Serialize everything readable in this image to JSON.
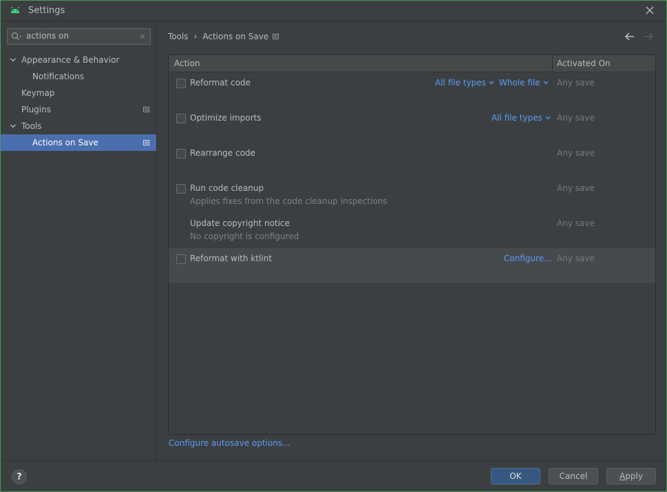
{
  "window": {
    "title": "Settings"
  },
  "colors": {
    "accent": "#4b6eaf",
    "link": "#589df6",
    "border": "#499c54",
    "primary_button": "#365880"
  },
  "search": {
    "value": "actions on"
  },
  "sidebar": {
    "items": [
      {
        "label": "Appearance & Behavior",
        "expanded": true
      },
      {
        "label": "Notifications"
      },
      {
        "label": "Keymap"
      },
      {
        "label": "Plugins"
      },
      {
        "label": "Tools",
        "expanded": true
      },
      {
        "label": "Actions on Save",
        "selected": true
      }
    ]
  },
  "breadcrumb": {
    "parent": "Tools",
    "separator": "›",
    "current": "Actions on Save"
  },
  "table": {
    "columns": [
      "Action",
      "Activated On"
    ],
    "rows": [
      {
        "name": "Reformat code",
        "checked": false,
        "links": [
          "All file types",
          "Whole file"
        ],
        "activated": "Any save"
      },
      {
        "name": "Optimize imports",
        "checked": false,
        "links": [
          "All file types"
        ],
        "activated": "Any save"
      },
      {
        "name": "Rearrange code",
        "checked": false,
        "activated": "Any save"
      },
      {
        "name": "Run code cleanup",
        "checked": false,
        "subtitle": "Applies fixes from the code cleanup inspections",
        "activated": "Any save"
      },
      {
        "name": "Update copyright notice",
        "subtitle": "No copyright is configured",
        "activated": "Any save"
      },
      {
        "name": "Reformat with ktlint",
        "checked": false,
        "links": [
          "Configure..."
        ],
        "activated": "Any save"
      }
    ]
  },
  "footer_link": "Configure autosave options...",
  "buttons": {
    "help": "?",
    "ok": "OK",
    "cancel": "Cancel",
    "apply_first": "A",
    "apply_rest": "pply"
  },
  "icons": [
    "android-icon",
    "close-icon",
    "search-icon",
    "clear-icon",
    "chevron-down-icon",
    "document-icon",
    "arrow-left-icon",
    "arrow-right-icon"
  ]
}
